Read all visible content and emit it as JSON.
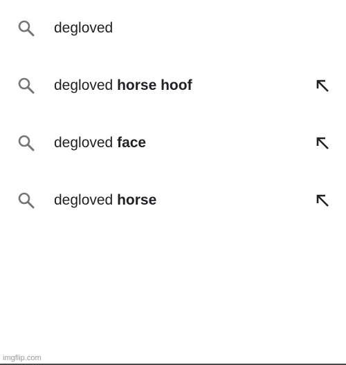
{
  "suggestions": [
    {
      "prefix": "degloved",
      "completion": "",
      "has_fill_arrow": false,
      "icon": "search-icon"
    },
    {
      "prefix": "degloved ",
      "completion": "horse hoof",
      "has_fill_arrow": true,
      "icon": "search-icon"
    },
    {
      "prefix": "degloved ",
      "completion": "face",
      "has_fill_arrow": true,
      "icon": "search-icon"
    },
    {
      "prefix": "degloved ",
      "completion": "horse",
      "has_fill_arrow": true,
      "icon": "search-icon"
    }
  ],
  "colors": {
    "icon": "#757575",
    "text": "#202124"
  },
  "watermark": "imgflip.com"
}
